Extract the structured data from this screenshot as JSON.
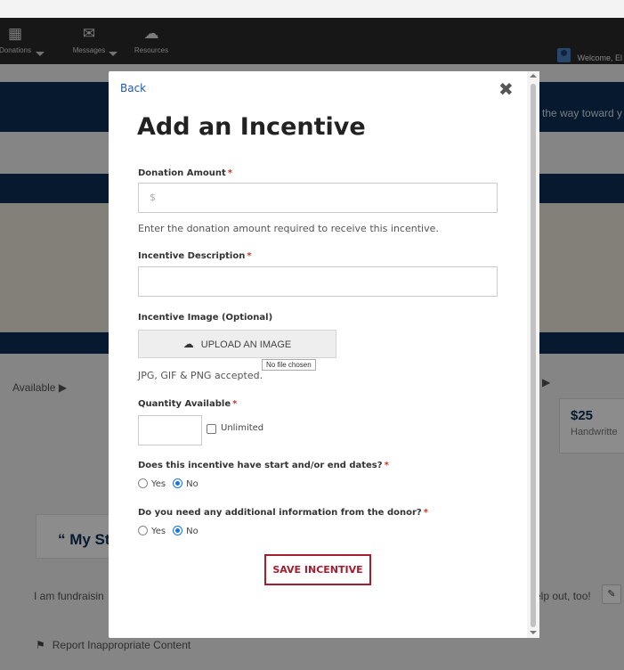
{
  "topnav": {
    "items": [
      {
        "label": "Donations",
        "icon": "gift-icon"
      },
      {
        "label": "Messages",
        "icon": "envelope-icon"
      },
      {
        "label": "Resources",
        "icon": "cloud-download-icon"
      }
    ],
    "welcome": "Welcome, El"
  },
  "background": {
    "banner_text": "the way toward y",
    "available_label": "Available ▶",
    "available_label_right": "▶",
    "card_price": "$25",
    "card_desc": "Handwritte",
    "story_heading": "“ My St",
    "fundraising_text": "I am fundraisin",
    "fundraising_text_right": "elp out, too!",
    "report_label": "Report Inappropriate Content"
  },
  "modal": {
    "back_label": "Back",
    "close_label": "✖",
    "title": "Add an Incentive",
    "donation_amount": {
      "label": "Donation Amount",
      "required": "*",
      "placeholder": "$",
      "help": "Enter the donation amount required to receive this incentive."
    },
    "incentive_description": {
      "label": "Incentive Description",
      "required": "*",
      "value": ""
    },
    "incentive_image": {
      "label": "Incentive Image (Optional)",
      "upload_label": "UPLOAD AN IMAGE",
      "accepted": "JPG, GIF & PNG accepted.",
      "file_chosen": "No file chosen"
    },
    "quantity": {
      "label": "Quantity Available",
      "required": "*",
      "unlimited_label": "Unlimited",
      "unlimited_checked": false
    },
    "dates_question": {
      "label": "Does this incentive have start and/or end dates?",
      "required": "*",
      "yes": "Yes",
      "no": "No",
      "selected": "No"
    },
    "info_question": {
      "label": "Do you need any additional information from the donor?",
      "required": "*",
      "yes": "Yes",
      "no": "No",
      "selected": "No"
    },
    "save_label": "SAVE INCENTIVE"
  },
  "colors": {
    "navy": "#0c2e57",
    "accent_red": "#a61d2f",
    "link_blue": "#2159a8",
    "radio_blue": "#1a73e8"
  }
}
